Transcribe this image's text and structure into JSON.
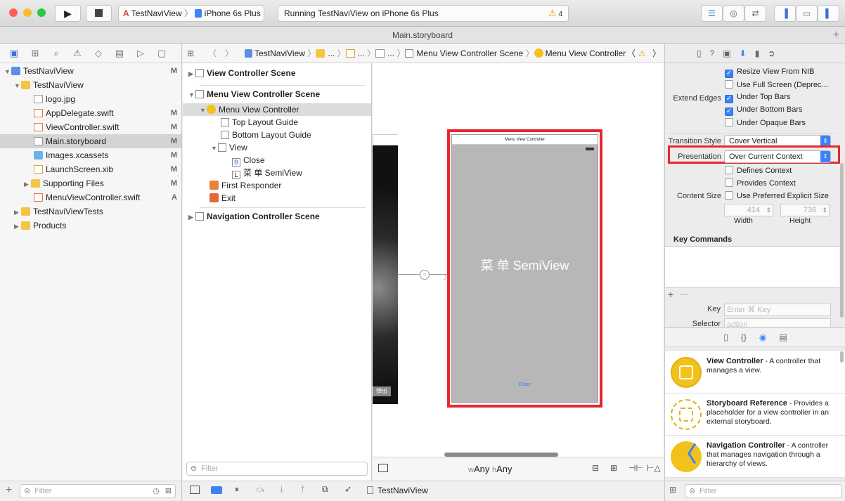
{
  "toolbar": {
    "scheme": "TestNaviView",
    "device": "iPhone 6s Plus",
    "status": "Running TestNaviView on iPhone 6s Plus",
    "warnings": "4"
  },
  "tab": {
    "title": "Main.storyboard"
  },
  "navigator": {
    "items": [
      {
        "label": "TestNaviView",
        "mark": "M"
      },
      {
        "label": "TestNaviView",
        "mark": ""
      },
      {
        "label": "logo.jpg",
        "mark": ""
      },
      {
        "label": "AppDelegate.swift",
        "mark": "M"
      },
      {
        "label": "ViewController.swift",
        "mark": "M"
      },
      {
        "label": "Main.storyboard",
        "mark": "M"
      },
      {
        "label": "Images.xcassets",
        "mark": "M"
      },
      {
        "label": "LaunchScreen.xib",
        "mark": "M"
      },
      {
        "label": "Supporting Files",
        "mark": "M"
      },
      {
        "label": "MenuViewController.swift",
        "mark": "A"
      },
      {
        "label": "TestNaviViewTests",
        "mark": ""
      },
      {
        "label": "Products",
        "mark": ""
      }
    ],
    "filter_placeholder": "Filter"
  },
  "jumpbar": {
    "project": "TestNaviView",
    "ellipsis1": "...",
    "ellipsis2": "...",
    "ellipsis3": "...",
    "scene": "Menu View Controller Scene",
    "controller": "Menu View Controller"
  },
  "outline": {
    "scene1": "View Controller Scene",
    "scene2": "Menu View Controller Scene",
    "menu_vc": "Menu View Controller",
    "top_guide": "Top Layout Guide",
    "bottom_guide": "Bottom Layout Guide",
    "view": "View",
    "close": "Close",
    "label": "菜  单 SemiView",
    "first_responder": "First Responder",
    "exit": "Exit",
    "scene3": "Navigation Controller Scene",
    "filter_placeholder": "Filter"
  },
  "canvas": {
    "vc_title": "Menu View Controller",
    "center_label": "菜  单 SemiView",
    "close_button": "Close",
    "back_button": "弹出",
    "size_class_w": "w",
    "size_class_w_val": "Any",
    "size_class_h": "h",
    "size_class_h_val": "Any"
  },
  "inspector": {
    "resize_nib": "Resize View From NIB",
    "full_screen": "Use Full Screen (Deprec...",
    "extend_edges": "Extend Edges",
    "under_top": "Under Top Bars",
    "under_bottom": "Under Bottom Bars",
    "under_opaque": "Under Opaque Bars",
    "transition_style_label": "Transition Style",
    "transition_style": "Cover Vertical",
    "presentation_label": "Presentation",
    "presentation": "Over Current Context",
    "defines_context": "Defines Context",
    "provides_context": "Provides Context",
    "content_size_label": "Content Size",
    "preferred_size": "Use Preferred Explicit Size",
    "width_val": "414",
    "height_val": "736",
    "width_label": "Width",
    "height_label": "Height",
    "key_commands": "Key Commands",
    "key_label": "Key",
    "key_placeholder": "Enter ⌘ Key",
    "selector_label": "Selector",
    "selector_placeholder": "action",
    "add": "+",
    "remove": "—"
  },
  "library": {
    "items": [
      {
        "title": "View Controller",
        "desc": " - A controller that manages a view."
      },
      {
        "title": "Storyboard Reference",
        "desc": " - Provides a placeholder for a view controller in an external storyboard."
      },
      {
        "title": "Navigation Controller",
        "desc": " - A controller that manages navigation through a hierarchy of views."
      }
    ],
    "filter_placeholder": "Filter"
  },
  "status": {
    "target": "TestNaviView"
  },
  "colors": {
    "highlight": "#e8262f",
    "accent": "#3b82f6",
    "folder": "#f4c542"
  }
}
